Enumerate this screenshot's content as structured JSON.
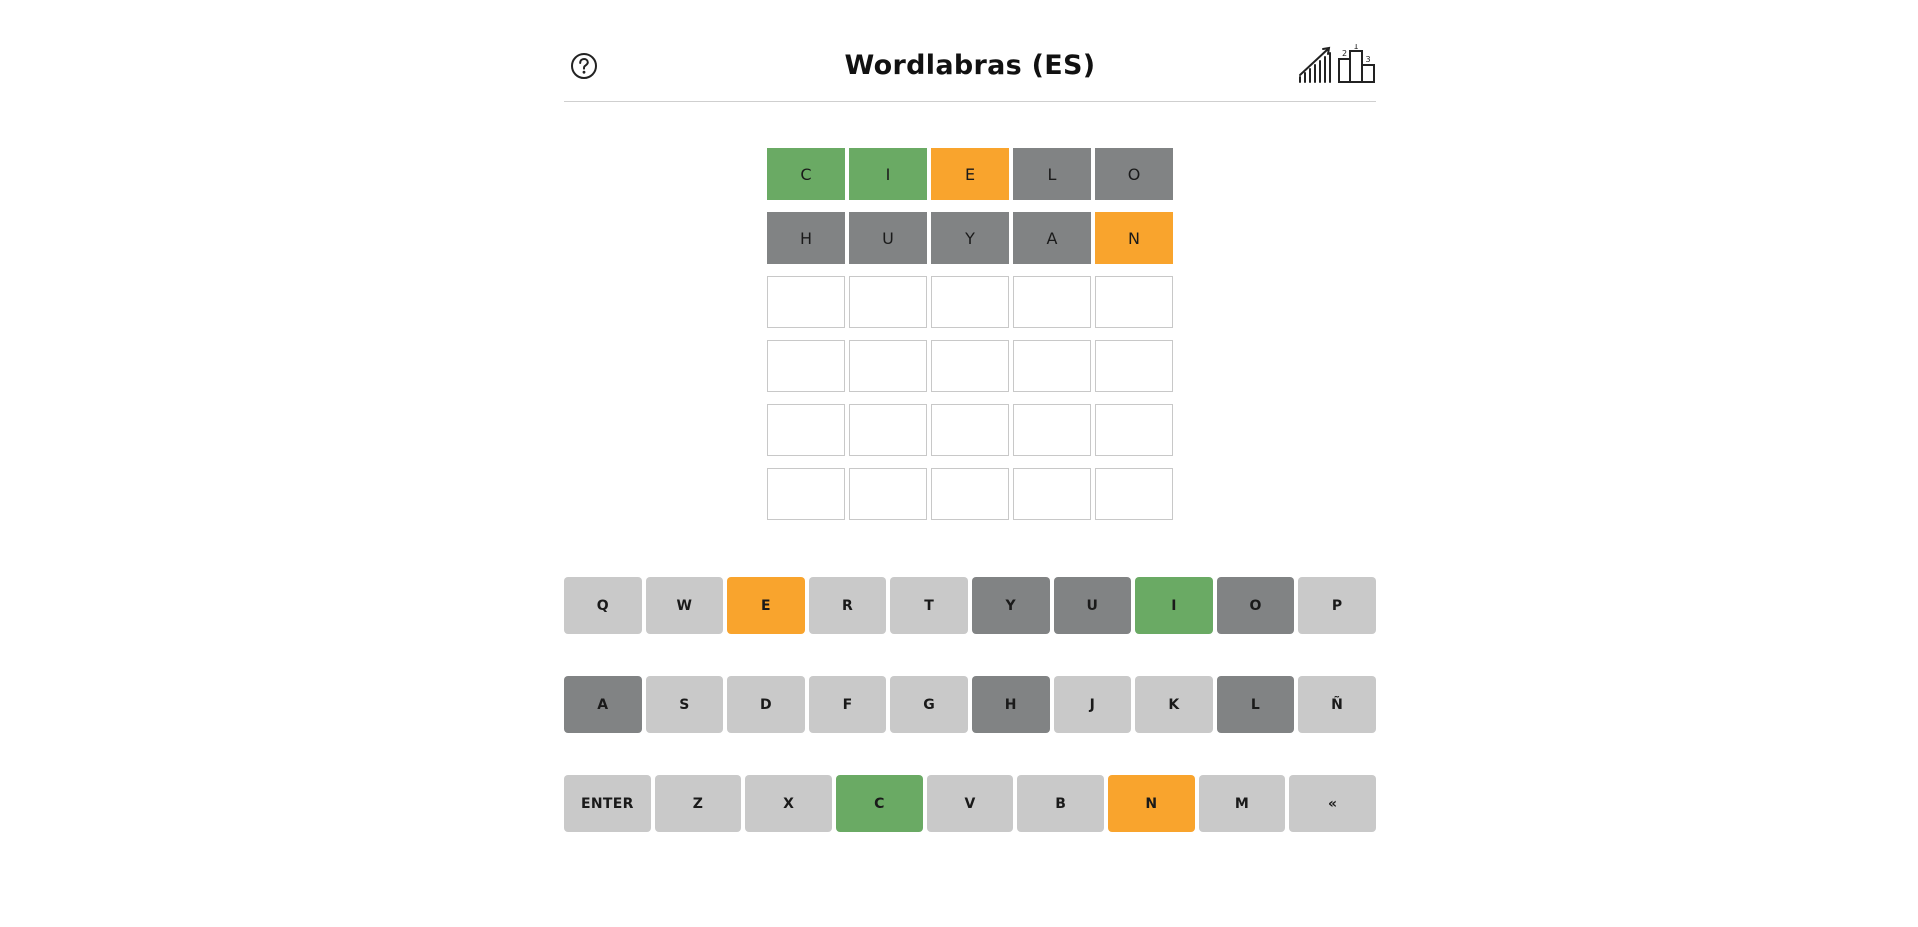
{
  "header": {
    "title": "Wordlabras (ES)",
    "help_icon": "question-circle-icon",
    "stats_icon": "stats-podium-icon",
    "podium_labels": [
      "2",
      "1",
      "3"
    ]
  },
  "colors": {
    "correct": "#6aaa64",
    "present": "#f9a42d",
    "absent": "#818384",
    "unused_key": "#c9c9c9"
  },
  "board": {
    "rows": [
      [
        {
          "letter": "C",
          "state": "correct"
        },
        {
          "letter": "I",
          "state": "correct"
        },
        {
          "letter": "E",
          "state": "present"
        },
        {
          "letter": "L",
          "state": "absent"
        },
        {
          "letter": "O",
          "state": "absent"
        }
      ],
      [
        {
          "letter": "H",
          "state": "absent"
        },
        {
          "letter": "U",
          "state": "absent"
        },
        {
          "letter": "Y",
          "state": "absent"
        },
        {
          "letter": "A",
          "state": "absent"
        },
        {
          "letter": "N",
          "state": "present"
        }
      ],
      [
        {
          "letter": "",
          "state": "empty"
        },
        {
          "letter": "",
          "state": "empty"
        },
        {
          "letter": "",
          "state": "empty"
        },
        {
          "letter": "",
          "state": "empty"
        },
        {
          "letter": "",
          "state": "empty"
        }
      ],
      [
        {
          "letter": "",
          "state": "empty"
        },
        {
          "letter": "",
          "state": "empty"
        },
        {
          "letter": "",
          "state": "empty"
        },
        {
          "letter": "",
          "state": "empty"
        },
        {
          "letter": "",
          "state": "empty"
        }
      ],
      [
        {
          "letter": "",
          "state": "empty"
        },
        {
          "letter": "",
          "state": "empty"
        },
        {
          "letter": "",
          "state": "empty"
        },
        {
          "letter": "",
          "state": "empty"
        },
        {
          "letter": "",
          "state": "empty"
        }
      ],
      [
        {
          "letter": "",
          "state": "empty"
        },
        {
          "letter": "",
          "state": "empty"
        },
        {
          "letter": "",
          "state": "empty"
        },
        {
          "letter": "",
          "state": "empty"
        },
        {
          "letter": "",
          "state": "empty"
        }
      ]
    ]
  },
  "keyboard": {
    "rows": [
      [
        {
          "label": "Q",
          "state": "unused"
        },
        {
          "label": "W",
          "state": "unused"
        },
        {
          "label": "E",
          "state": "present"
        },
        {
          "label": "R",
          "state": "unused"
        },
        {
          "label": "T",
          "state": "unused"
        },
        {
          "label": "Y",
          "state": "absent"
        },
        {
          "label": "U",
          "state": "absent"
        },
        {
          "label": "I",
          "state": "correct"
        },
        {
          "label": "O",
          "state": "absent"
        },
        {
          "label": "P",
          "state": "unused"
        }
      ],
      [
        {
          "label": "A",
          "state": "absent"
        },
        {
          "label": "S",
          "state": "unused"
        },
        {
          "label": "D",
          "state": "unused"
        },
        {
          "label": "F",
          "state": "unused"
        },
        {
          "label": "G",
          "state": "unused"
        },
        {
          "label": "H",
          "state": "absent"
        },
        {
          "label": "J",
          "state": "unused"
        },
        {
          "label": "K",
          "state": "unused"
        },
        {
          "label": "L",
          "state": "absent"
        },
        {
          "label": "Ñ",
          "state": "unused"
        }
      ],
      [
        {
          "label": "ENTER",
          "state": "unused"
        },
        {
          "label": "Z",
          "state": "unused"
        },
        {
          "label": "X",
          "state": "unused"
        },
        {
          "label": "C",
          "state": "correct"
        },
        {
          "label": "V",
          "state": "unused"
        },
        {
          "label": "B",
          "state": "unused"
        },
        {
          "label": "N",
          "state": "present"
        },
        {
          "label": "M",
          "state": "unused"
        },
        {
          "label": "«",
          "state": "unused"
        }
      ]
    ]
  }
}
